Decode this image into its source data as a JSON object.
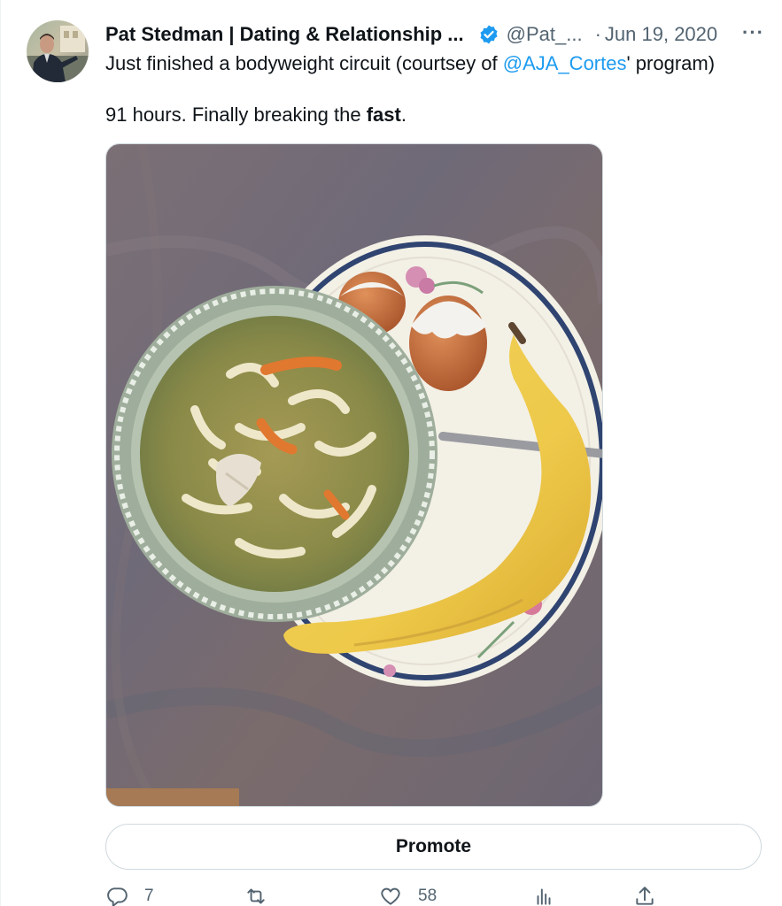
{
  "author": {
    "display_name": "Pat Stedman | Dating & Relationship ...",
    "handle": "@Pat_...",
    "separator": "·",
    "date": "Jun 19, 2020",
    "verified": true
  },
  "tweet": {
    "line1_prefix": "Just finished a bodyweight circuit (courtsey of ",
    "mention": "@AJA_Cortes",
    "line1_suffix": "' program)",
    "line2_prefix": "91 hours. Finally breaking the ",
    "line2_bold": "fast",
    "line2_suffix": "."
  },
  "more_menu_label": "···",
  "promote_label": "Promote",
  "actions": {
    "reply_count": "7",
    "retweet_count": "",
    "like_count": "58",
    "views_count": "",
    "share_count": ""
  },
  "icons": {
    "verified": "verified-badge-icon",
    "reply": "reply-icon",
    "retweet": "retweet-icon",
    "like": "heart-icon",
    "views": "views-icon",
    "share": "share-icon",
    "more": "more-icon"
  },
  "colors": {
    "link": "#1d9bf0",
    "secondary_text": "#536471",
    "primary_text": "#0f1419",
    "border": "#cfd9de"
  }
}
